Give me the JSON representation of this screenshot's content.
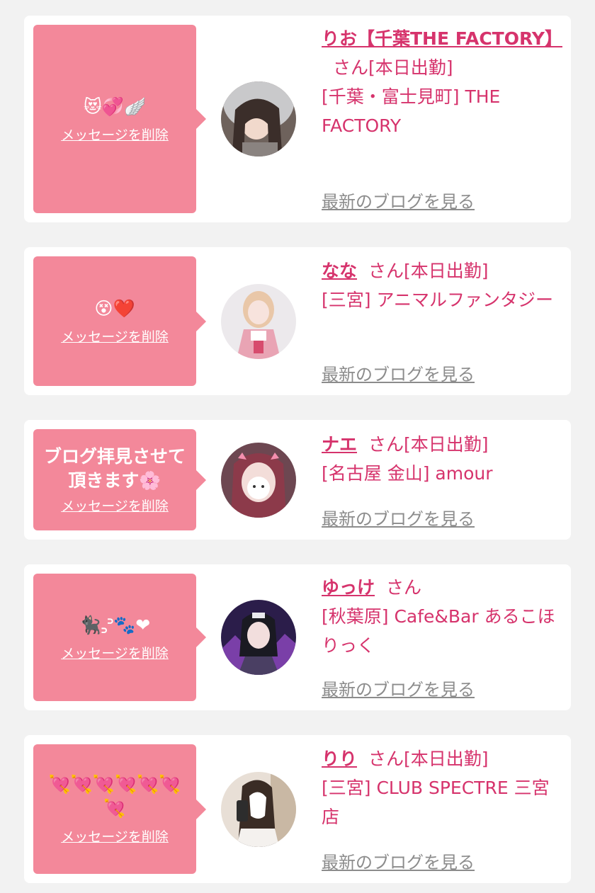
{
  "delete_label": "メッセージを削除",
  "blog_label": "最新のブログを見る",
  "colors": {
    "accent": "#d6336c",
    "bubble": "#f3889a",
    "link_gray": "#8c8c8c",
    "background": "#f2f2f2"
  },
  "cards": [
    {
      "message": "😻💞🪽",
      "name": "りお【千葉THE FACTORY】",
      "suffix": "さん[本日出勤]",
      "shop": "[千葉・富士見町] THE FACTORY"
    },
    {
      "message": "😵❤️",
      "name": "なな",
      "suffix": "さん[本日出勤]",
      "shop": "[三宮] アニマルファンタジー"
    },
    {
      "message": "ブログ拝見させて頂きます🌸",
      "name": "ナエ",
      "suffix": "さん[本日出勤]",
      "shop": "[名古屋 金山] amour"
    },
    {
      "message": "🐈‍⬛꜆꜄🐾❤",
      "name": "ゆっけ",
      "suffix": "さん",
      "shop": "[秋葉原] Cafe&Bar あるこほりっく"
    },
    {
      "message": "💘💘💘💘💘💘💘",
      "name": "りり",
      "suffix": "さん[本日出勤]",
      "shop": "[三宮] CLUB SPECTRE 三宮店"
    }
  ]
}
